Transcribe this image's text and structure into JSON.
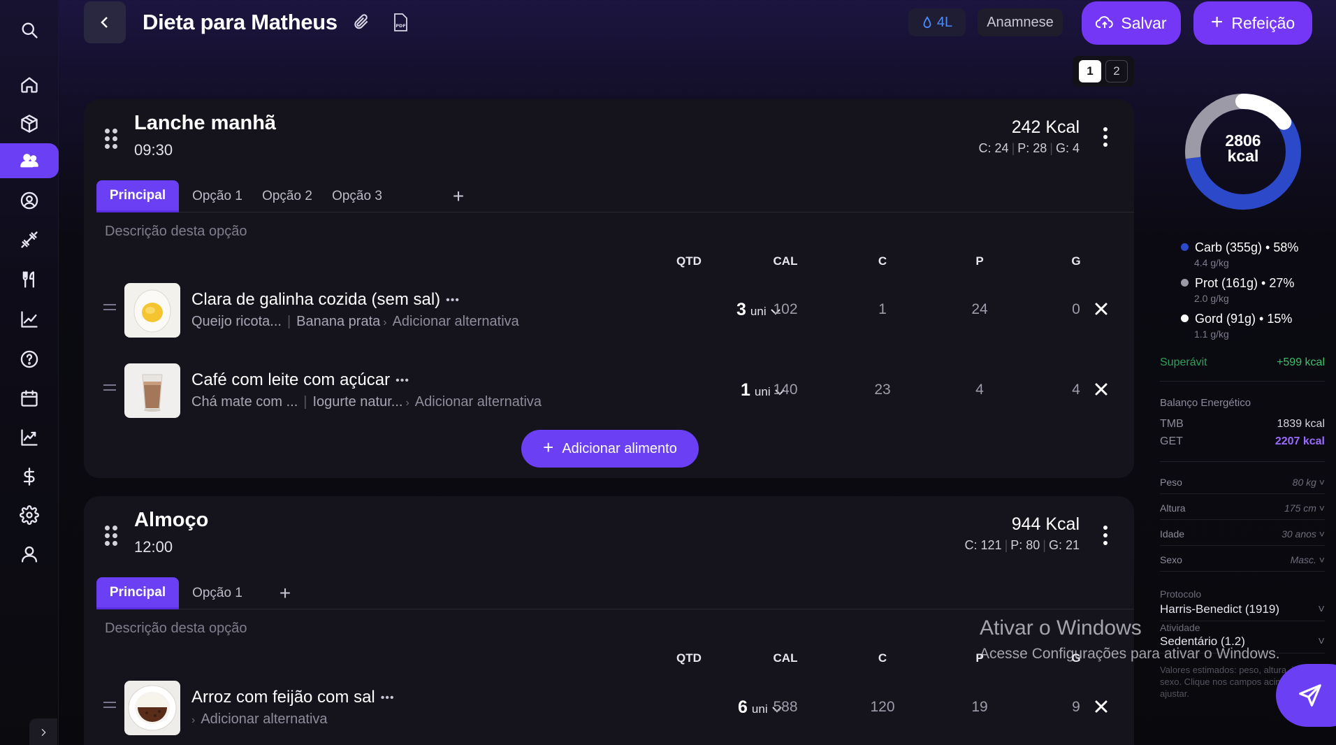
{
  "header": {
    "title": "Dieta para Matheus",
    "water": "4L",
    "anamnese": "Anamnese",
    "save": "Salvar",
    "add_meal": "Refeição",
    "pages": [
      "1",
      "2"
    ]
  },
  "columns": {
    "qtd": "QTD",
    "cal": "CAL",
    "c": "C",
    "p": "P",
    "g": "G"
  },
  "meals": [
    {
      "name": "Lanche manhã",
      "time": "09:30",
      "kcal": "242 Kcal",
      "macros": {
        "c": "C: 24",
        "p": "P: 28",
        "g": "G: 4"
      },
      "tabs": [
        "Principal",
        "Opção 1",
        "Opção 2",
        "Opção 3"
      ],
      "description_placeholder": "Descrição desta opção",
      "foods": [
        {
          "name": "Clara de galinha cozida (sem sal)",
          "alts": [
            "Queijo ricota...",
            "Banana prata"
          ],
          "add_alt": "Adicionar alternativa",
          "qty": "3",
          "unit": "uni",
          "cal": "102",
          "c": "1",
          "p": "24",
          "g": "0"
        },
        {
          "name": "Café com leite com açúcar",
          "alts": [
            "Chá mate com ...",
            "Iogurte natur..."
          ],
          "add_alt": "Adicionar alternativa",
          "qty": "1",
          "unit": "uni",
          "cal": "140",
          "c": "23",
          "p": "4",
          "g": "4"
        }
      ],
      "add_food": "Adicionar alimento"
    },
    {
      "name": "Almoço",
      "time": "12:00",
      "kcal": "944 Kcal",
      "macros": {
        "c": "C: 121",
        "p": "P: 80",
        "g": "G: 21"
      },
      "tabs": [
        "Principal",
        "Opção 1"
      ],
      "description_placeholder": "Descrição desta opção",
      "foods": [
        {
          "name": "Arroz com feijão com sal",
          "alts": [],
          "add_alt": "Adicionar alternativa",
          "qty": "6",
          "unit": "uni",
          "cal": "588",
          "c": "120",
          "p": "19",
          "g": "9"
        }
      ]
    }
  ],
  "summary": {
    "total_kcal": "2806",
    "kcal_unit": "kcal",
    "macro_split": {
      "carb_pct": 58,
      "prot_pct": 27,
      "gord_pct": 15
    },
    "legend": [
      {
        "label": "Carb (355g) • 58%",
        "sub": "4.4 g/kg",
        "color": "#2b49c9"
      },
      {
        "label": "Prot (161g) • 27%",
        "sub": "2.0 g/kg",
        "color": "#9b9aa6"
      },
      {
        "label": "Gord (91g) • 15%",
        "sub": "1.1 g/kg",
        "color": "#ffffff"
      }
    ],
    "surplus_label": "Superávit",
    "surplus_value": "+599 kcal",
    "balance_title": "Balanço Energético",
    "tmb_label": "TMB",
    "tmb_value": "1839 kcal",
    "get_label": "GET",
    "get_value": "2207 kcal",
    "fields": [
      {
        "label": "Peso",
        "value": "80 kg"
      },
      {
        "label": "Altura",
        "value": "175 cm"
      },
      {
        "label": "Idade",
        "value": "30 anos"
      },
      {
        "label": "Sexo",
        "value": "Masc."
      }
    ],
    "protocol_label": "Protocolo",
    "protocol_value": "Harris-Benedict (1919)",
    "activity_label": "Atividade",
    "activity_value": "Sedentário (1.2)",
    "note": "Valores estimados: peso, altura, idade, sexo. Clique nos campos acima para ajustar."
  },
  "watermark": {
    "line1": "Ativar o Windows",
    "line2": "Acesse Configurações para ativar o Windows."
  }
}
